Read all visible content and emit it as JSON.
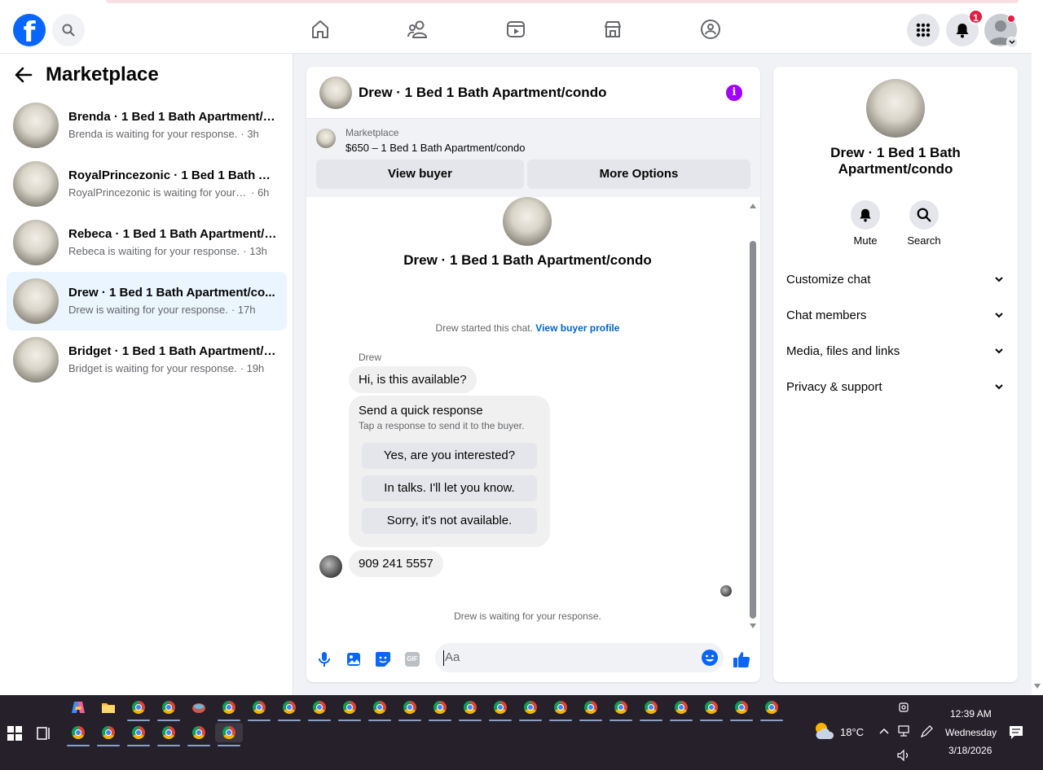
{
  "navbar": {
    "logo_letter": "f",
    "notifications_count": "1"
  },
  "sidebar": {
    "title": "Marketplace",
    "conversations": [
      {
        "name": "Brenda · 1 Bed 1 Bath Apartment/c...",
        "preview": "Brenda is waiting for your response.",
        "time": "· 3h",
        "active": false
      },
      {
        "name": "RoyalPrincezonic · 1 Bed 1 Bath Ap...",
        "preview": "RoyalPrincezonic is waiting for your r...",
        "time": "· 6h",
        "active": false
      },
      {
        "name": "Rebeca · 1 Bed 1 Bath Apartment/c...",
        "preview": "Rebeca is waiting for your response.",
        "time": "· 13h",
        "active": false
      },
      {
        "name": "Drew · 1 Bed 1 Bath Apartment/co...",
        "preview": "Drew is waiting for your response.",
        "time": "· 17h",
        "active": true
      },
      {
        "name": "Bridget · 1 Bed 1 Bath Apartment/c...",
        "preview": "Bridget is waiting for your response.",
        "time": "· 19h",
        "active": false
      }
    ]
  },
  "chat": {
    "title": "Drew · 1 Bed 1 Bath Apartment/condo",
    "info_glyph": "i",
    "listing": {
      "label": "Marketplace",
      "price_title": "$650 – 1 Bed 1 Bath Apartment/condo",
      "view_buyer": "View buyer",
      "more_options": "More Options"
    },
    "body": {
      "title": "Drew · 1 Bed 1 Bath Apartment/condo",
      "started_text": "Drew started this chat.",
      "view_profile": "View buyer profile",
      "sender": "Drew",
      "message1": "Hi, is this available?",
      "quick_title": "Send a quick response",
      "quick_sub": "Tap a response to send it to the buyer.",
      "quick_replies": [
        "Yes, are you interested?",
        "In talks. I'll let you know.",
        "Sorry, it's not available."
      ],
      "message2": "909 241 5557",
      "waiting": "Drew is waiting for your response."
    },
    "composer": {
      "placeholder": "Aa",
      "gif_label": "GIF"
    }
  },
  "details": {
    "title": "Drew · 1 Bed 1 Bath Apartment/condo",
    "actions": [
      {
        "label": "Mute",
        "icon": "bell-icon"
      },
      {
        "label": "Search",
        "icon": "search-icon"
      }
    ],
    "sections": [
      "Customize chat",
      "Chat members",
      "Media, files and links",
      "Privacy & support"
    ]
  },
  "taskbar": {
    "temperature": "18°C",
    "time": "12:39 AM",
    "day": "Wednesday",
    "date": "3/18/2026"
  },
  "colors": {
    "facebook_blue": "#0866ff",
    "messenger_blue": "#0064d1",
    "info_purple": "#a100ff",
    "badge_red": "#e41e3f",
    "active_row": "#ebf5ff"
  }
}
